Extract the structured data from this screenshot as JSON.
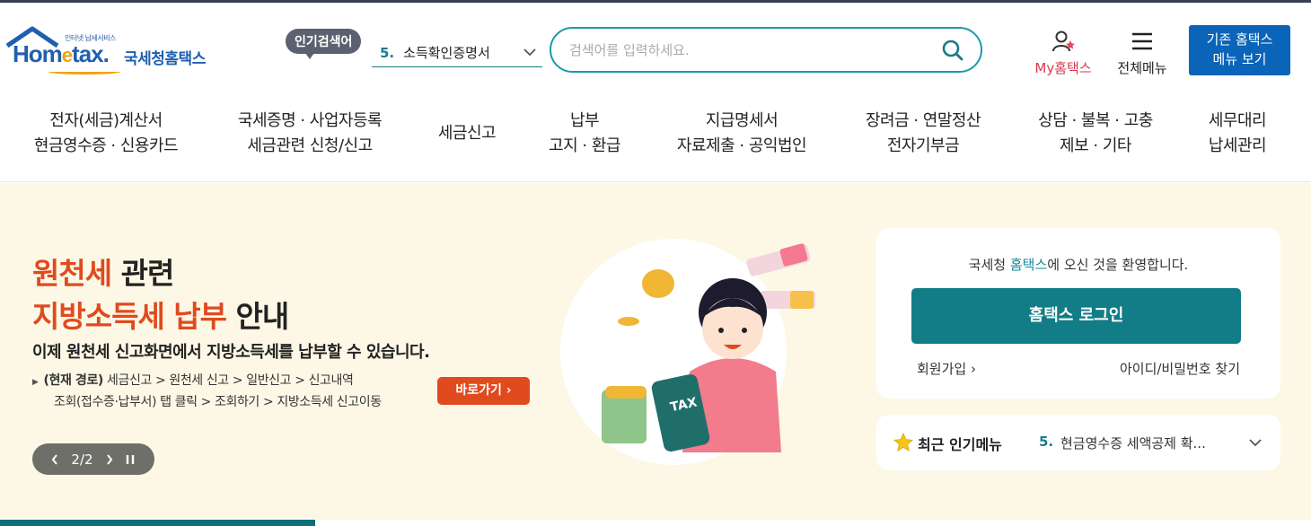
{
  "header": {
    "logo": {
      "tagline": "인터넷 납세서비스",
      "brand_pre": "Hom",
      "brand_e": "e",
      "brand_post": "tax.",
      "agency": "국세청홈택스"
    },
    "popular": {
      "badge": "인기검색어",
      "rank": "5.",
      "term": "소득확인증명서"
    },
    "search": {
      "placeholder": "검색어를 입력하세요."
    },
    "my_hometax": "My홈택스",
    "all_menu": "전체메뉴",
    "legacy_button": {
      "line1": "기존 홈택스",
      "line2": "메뉴 보기"
    }
  },
  "nav": [
    {
      "line1": "전자(세금)계산서",
      "line2": "현금영수증 · 신용카드"
    },
    {
      "line1": "국세증명 · 사업자등록",
      "line2": "세금관련 신청/신고"
    },
    {
      "line1": "세금신고",
      "line2": ""
    },
    {
      "line1": "납부",
      "line2": "고지 · 환급"
    },
    {
      "line1": "지급명세서",
      "line2": "자료제출 · 공익법인"
    },
    {
      "line1": "장려금 · 연말정산",
      "line2": "전자기부금"
    },
    {
      "line1": "상담 · 불복 · 고충",
      "line2": "제보 · 기타"
    },
    {
      "line1": "세무대리",
      "line2": "납세관리"
    }
  ],
  "hero": {
    "title1_red": "원천세",
    "title1_rest": " 관련",
    "title2_red": "지방소득세 납부",
    "title2_rest": " 안내",
    "subtitle": "이제 원천세 신고화면에서 지방소득세를 납부할 수 있습니다.",
    "path_label": "(현재 경로)",
    "path_line1": " 세금신고 > 원천세 신고 > 일반신고 > 신고내역",
    "path_line2": "조회(접수증·납부서) 탭 클릭 > 조회하기 > 지방소득세 신고이동",
    "go_button": "바로가기",
    "pager": "2/2",
    "illustration_text": "TAX"
  },
  "login": {
    "welcome_pre": "국세청 ",
    "welcome_hl": "홈택스",
    "welcome_post": "에 오신 것을 환영합니다.",
    "login_button": "홈택스 로그인",
    "join": "회원가입",
    "find": "아이디/비밀번호 찾기"
  },
  "recent": {
    "label": "최근 인기메뉴",
    "rank": "5.",
    "text": "현금영수증 세액공제 확..."
  },
  "colors": {
    "teal": "#127d86",
    "accent_red": "#e04a1f",
    "brand_blue": "#1f5fae",
    "hero_bg": "#fdf8e6"
  }
}
